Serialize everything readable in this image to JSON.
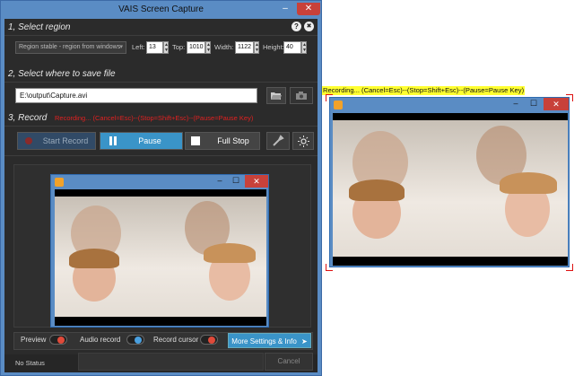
{
  "window": {
    "title": "VAIS Screen Capture",
    "minimize_glyph": "–",
    "close_glyph": "✕",
    "help_glyph": "?",
    "exit_glyph": "✖"
  },
  "region": {
    "header": "1, Select region",
    "mode_value": "Region stable - region from windows",
    "left_label": "Left:",
    "left_value": "13",
    "top_label": "Top:",
    "top_value": "1010",
    "width_label": "Width:",
    "width_value": "1122",
    "height_label": "Height:",
    "height_value": "40"
  },
  "save": {
    "header": "2, Select where to save file",
    "path_value": "E:\\output\\Capture.avi",
    "browse_icon": "folder-open-icon",
    "options_icon": "camera-icon"
  },
  "record": {
    "header": "3, Record",
    "status_text": "Recording... (Cancel=Esc)--(Stop=Shift+Esc)--(Pause=Pause Key)",
    "start_label": "Start Record",
    "pause_label": "Pause",
    "fullstop_label": "Full Stop",
    "tools_icon": "tools-icon",
    "brightness_icon": "sun-icon"
  },
  "options": {
    "preview_label": "Preview",
    "audio_label": "Audio record",
    "cursor_label": "Record cursor",
    "more_label": "More Settings & Info"
  },
  "status": {
    "text": "No Status",
    "cancel_label": "Cancel"
  },
  "overlay": {
    "hint": "Recording... (Cancel=Esc)--(Stop=Shift+Esc)--(Pause=Pause Key)"
  },
  "mini_window": {
    "min_glyph": "–",
    "max_glyph": "☐",
    "close_glyph": "✕"
  },
  "colors": {
    "accent": "#3a94c8",
    "window_frame": "#5a8cc4",
    "record_text": "#e02020",
    "hint_bg": "#ffff30"
  }
}
